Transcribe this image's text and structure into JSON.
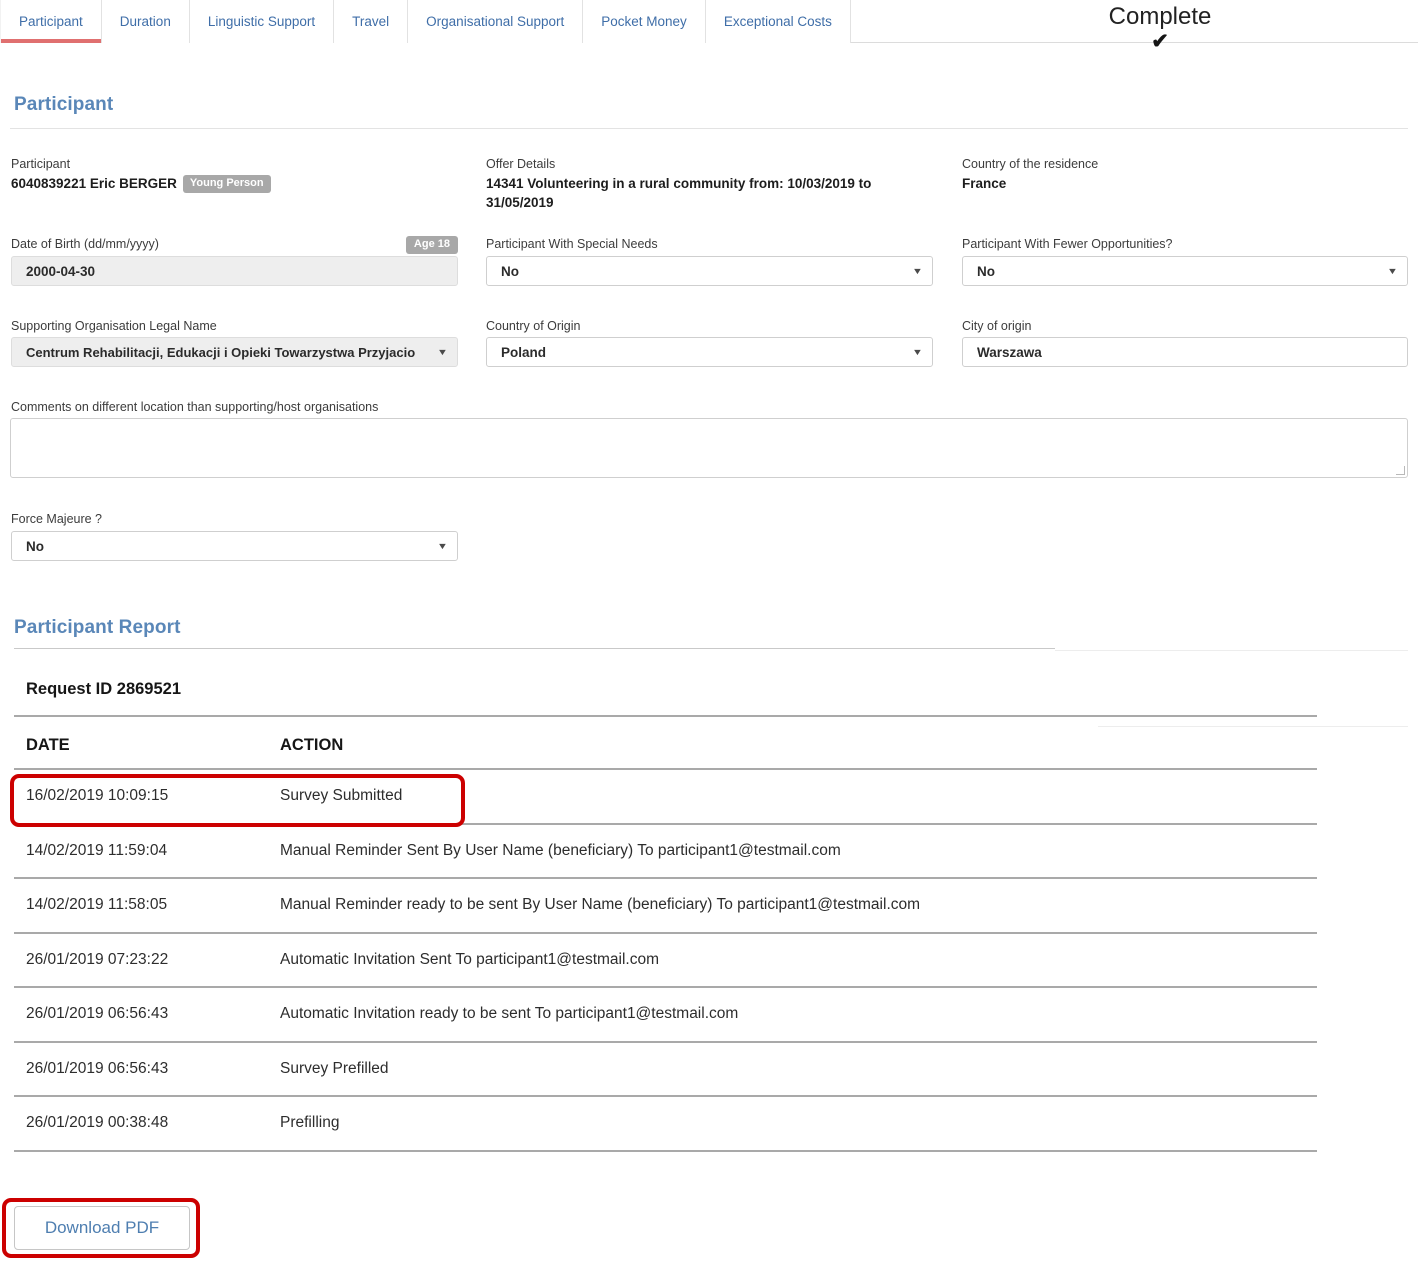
{
  "tabs": [
    {
      "label": "Participant",
      "active": true
    },
    {
      "label": "Duration",
      "active": false
    },
    {
      "label": "Linguistic Support",
      "active": false
    },
    {
      "label": "Travel",
      "active": false
    },
    {
      "label": "Organisational Support",
      "active": false
    },
    {
      "label": "Pocket Money",
      "active": false
    },
    {
      "label": "Exceptional Costs",
      "active": false
    }
  ],
  "status": {
    "label": "Complete",
    "check": "✔"
  },
  "participant_section": {
    "title": "Participant",
    "participant_label": "Participant",
    "participant_value": "6040839221 Eric BERGER",
    "participant_badge": "Young Person",
    "offer_label": "Offer Details",
    "offer_value": "14341 Volunteering in a rural community from: 10/03/2019 to 31/05/2019",
    "residence_label": "Country of the residence",
    "residence_value": "France",
    "dob_label": "Date of Birth (dd/mm/yyyy)",
    "dob_badge": "Age 18",
    "dob_value": "2000-04-30",
    "special_needs_label": "Participant With Special Needs",
    "special_needs_value": "No",
    "fewer_opportunities_label": "Participant With Fewer Opportunities?",
    "fewer_opportunities_value": "No",
    "supporting_org_label": "Supporting Organisation Legal Name",
    "supporting_org_value": "Centrum Rehabilitacji, Edukacji i Opieki Towarzystwa Przyjacio",
    "country_origin_label": "Country of Origin",
    "country_origin_value": "Poland",
    "city_origin_label": "City of origin",
    "city_origin_value": "Warszawa",
    "comments_label": "Comments on different location than supporting/host organisations",
    "comments_value": "",
    "force_majeure_label": "Force Majeure ?",
    "force_majeure_value": "No",
    "caret": "▼"
  },
  "report_section": {
    "title": "Participant Report",
    "request_id": "Request ID 2869521",
    "columns": [
      "DATE",
      "ACTION"
    ],
    "rows": [
      {
        "date": "16/02/2019 10:09:15",
        "action": "Survey Submitted",
        "highlighted": true
      },
      {
        "date": "14/02/2019 11:59:04",
        "action": "Manual Reminder Sent By User Name (beneficiary) To participant1@testmail.com",
        "highlighted": false
      },
      {
        "date": "14/02/2019 11:58:05",
        "action": "Manual Reminder ready to be sent By User Name (beneficiary) To participant1@testmail.com",
        "highlighted": false
      },
      {
        "date": "26/01/2019 07:23:22",
        "action": "Automatic Invitation Sent To participant1@testmail.com",
        "highlighted": false
      },
      {
        "date": "26/01/2019 06:56:43",
        "action": "Automatic Invitation ready to be sent To participant1@testmail.com",
        "highlighted": false
      },
      {
        "date": "26/01/2019 06:56:43",
        "action": "Survey Prefilled",
        "highlighted": false
      },
      {
        "date": "26/01/2019 00:38:48",
        "action": "Prefilling",
        "highlighted": false
      }
    ],
    "download_label": "Download PDF"
  },
  "colors": {
    "accent_tab_active": "#e07070",
    "heading_blue": "#5a87b8",
    "tab_text": "#3f6ea8",
    "highlight_red": "#cc0000",
    "badge_grey": "#a8a8a8",
    "link_blue": "#4e7eb0"
  }
}
